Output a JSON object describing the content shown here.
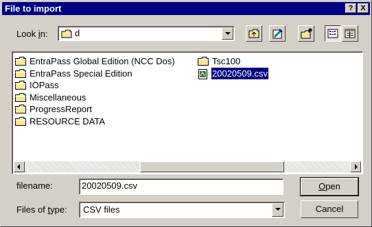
{
  "window": {
    "title": "File to import",
    "help_label": "?",
    "close_label": "X"
  },
  "look_in": {
    "label_pre": "Look ",
    "label_mnemonic": "i",
    "label_post": "n:",
    "value": "d"
  },
  "toolbar": {
    "buttons": [
      "up-one-level",
      "search-web",
      "create-new-folder",
      "list-view",
      "details-view"
    ]
  },
  "files": {
    "column1": [
      {
        "name": "EntraPass Global Edition (NCC Dos)",
        "type": "folder"
      },
      {
        "name": "EntraPass Special Edition",
        "type": "folder"
      },
      {
        "name": "IOPass",
        "type": "folder"
      },
      {
        "name": "Miscellaneous",
        "type": "folder"
      },
      {
        "name": "ProgressReport",
        "type": "folder"
      },
      {
        "name": "RESOURCE DATA",
        "type": "folder"
      }
    ],
    "column2": [
      {
        "name": "Tsc100",
        "type": "folder"
      },
      {
        "name": "20020509.csv",
        "type": "csv",
        "selected": true
      }
    ]
  },
  "filename": {
    "label": "filename:",
    "value": "20020509.csv"
  },
  "filetype": {
    "label_pre": "Files of ",
    "label_mnemonic": "t",
    "label_post": "ype:",
    "value": "CSV files"
  },
  "buttons": {
    "open_mnemonic": "O",
    "open_rest": "pen",
    "cancel": "Cancel"
  },
  "colors": {
    "title_bg": "#000080",
    "dialog_bg": "#d4d0c8",
    "selection": "#000080"
  }
}
